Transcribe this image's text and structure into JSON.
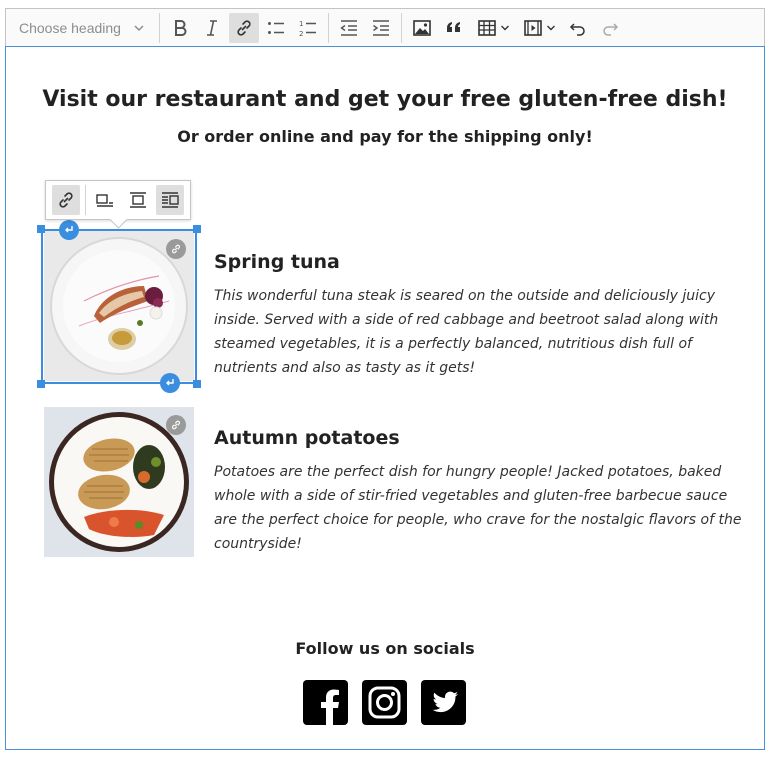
{
  "toolbar": {
    "heading_placeholder": "Choose heading",
    "icons": [
      "bold-icon",
      "italic-icon",
      "link-icon",
      "bulleted-list-icon",
      "numbered-list-icon",
      "outdent-icon",
      "indent-icon",
      "image-icon",
      "blockquote-icon",
      "table-icon",
      "media-icon",
      "undo-icon",
      "redo-icon"
    ],
    "active": "link"
  },
  "content": {
    "title": "Visit our restaurant and get your free gluten-free dish!",
    "subtitle": "Or order online and pay for the shipping only!",
    "dishes": [
      {
        "title": "Spring tuna",
        "description": "This wonderful tuna steak is seared on the outside and deliciously juicy inside. Served with a side of red cabbage and beetroot salad along with steamed vegetables, it is a perfectly balanced, nutritious dish full of nutrients and also as tasty as it gets!"
      },
      {
        "title": "Autumn potatoes",
        "description": "Potatoes are the perfect dish for hungry people! Jacked potatoes, baked whole with a side of stir-fried vegetables and gluten-free barbecue sauce are the perfect choice for people, who crave for the nostalgic flavors of the countryside!"
      }
    ],
    "follow": "Follow us on socials",
    "socials": [
      "facebook",
      "instagram",
      "twitter"
    ]
  },
  "colors": {
    "accent": "#3b8de0",
    "border": "#c4c4c4",
    "active_bg": "#dedede"
  }
}
